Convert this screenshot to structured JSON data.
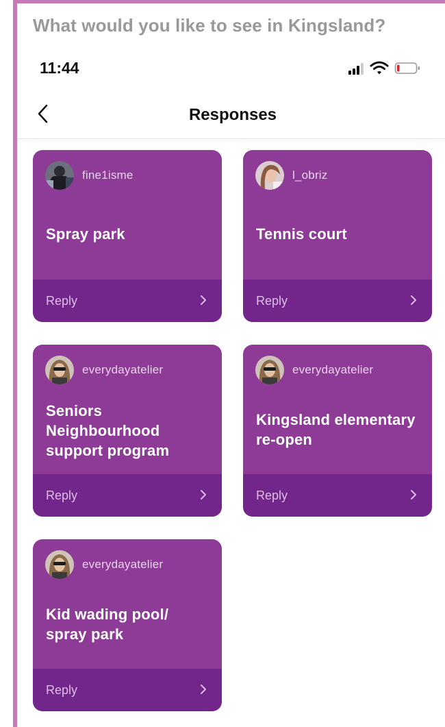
{
  "headline": "What would you like to see in Kingsland?",
  "status": {
    "time": "11:44"
  },
  "nav": {
    "title": "Responses"
  },
  "cards": [
    {
      "user": "fine1isme",
      "text": "Spray park",
      "reply": "Reply"
    },
    {
      "user": "l_obriz",
      "text": "Tennis court",
      "reply": "Reply"
    },
    {
      "user": "everydayatelier",
      "text": "Seniors Neighbourhood support program",
      "reply": "Reply"
    },
    {
      "user": "everydayatelier",
      "text": "Kingsland elementary re-open",
      "reply": "Reply"
    },
    {
      "user": "everydayatelier",
      "text": "Kid wading pool/ spray park",
      "reply": "Reply"
    }
  ],
  "colors": {
    "card": "#8d3b96",
    "reply_bar": "#72258a",
    "frame": "#c67ab5"
  },
  "icons": [
    "back-chevron-icon",
    "signal-icon",
    "wifi-icon",
    "battery-icon",
    "chevron-right-icon"
  ]
}
